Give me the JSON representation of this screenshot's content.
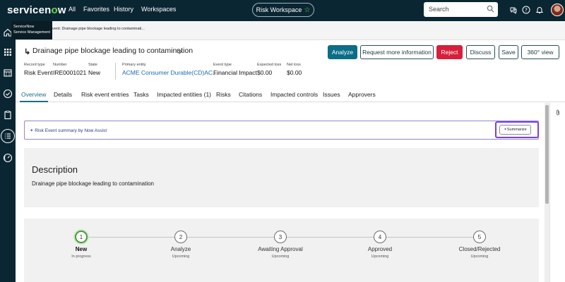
{
  "app": {
    "logo_text": "servicenow",
    "nav": [
      "All",
      "Favorites",
      "History",
      "Workspaces"
    ],
    "workspace_label": "Risk Workspace",
    "search_placeholder": "Search",
    "tooltip_line1": "ServiceNow",
    "tooltip_line2": "Service Management",
    "breadcrumb": "vent: Drainage pipe blockage leading to contaminati..."
  },
  "record": {
    "title": "Drainage pipe blockage leading to contamination",
    "fields": [
      {
        "label": "Record type",
        "value": "Risk Event"
      },
      {
        "label": "Number",
        "value": "IRE0001021"
      },
      {
        "label": "State",
        "value": "New"
      },
      {
        "label": "Primary entity",
        "value": "ACME Consumer Durable(CD)AC..."
      },
      {
        "label": "Event type",
        "value": "Financial Impact"
      },
      {
        "label": "Expected loss",
        "value": "$0.00"
      },
      {
        "label": "Net loss",
        "value": "$0.00"
      }
    ],
    "buttons": {
      "analyze": "Analyze",
      "request_info": "Request more information",
      "reject": "Reject",
      "discuss": "Discuss",
      "save": "Save",
      "view360": "360° view"
    }
  },
  "tabs": [
    "Overview",
    "Details",
    "Risk event entries",
    "Tasks",
    "Impacted entities (1)",
    "Risks",
    "Citations",
    "Impacted controls",
    "Issues",
    "Approvers"
  ],
  "active_tab": "Overview",
  "assist": {
    "text": "Risk Event summary by Now Assist",
    "summarize_label": "Summarize"
  },
  "description": {
    "heading": "Description",
    "body": "Drainage pipe blockage leading to contamination"
  },
  "stages": [
    {
      "number": "1",
      "name": "New",
      "status": "In progress",
      "current": true
    },
    {
      "number": "2",
      "name": "Analyze",
      "status": "Upcoming",
      "current": false
    },
    {
      "number": "3",
      "name": "Awaiting Approval",
      "status": "Upcoming",
      "current": false
    },
    {
      "number": "4",
      "name": "Approved",
      "status": "Upcoming",
      "current": false
    },
    {
      "number": "5",
      "name": "Closed/Rejected",
      "status": "Upcoming",
      "current": false
    }
  ],
  "colors": {
    "topbar": "#0b2633",
    "primary_button": "#0c6d86",
    "reject_button": "#d71f3b",
    "assist_highlight": "#7b3df0",
    "current_stage": "#4a9a3e"
  }
}
